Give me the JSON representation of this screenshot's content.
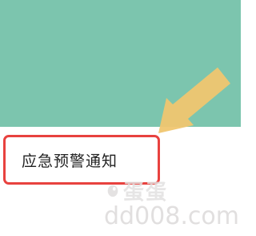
{
  "menu": {
    "item_label": "应急预警通知"
  },
  "watermark": {
    "cn_text": "蛋蛋",
    "url": "dd008.com"
  },
  "colors": {
    "teal_background": "#7cc5ae",
    "panel_background": "#ffffff",
    "highlight_border": "#e8423f",
    "arrow": "#f0c670"
  },
  "icons": {
    "pointer_arrow": "arrow-pointing-down-left",
    "watermark_logo": "egg-logo"
  }
}
